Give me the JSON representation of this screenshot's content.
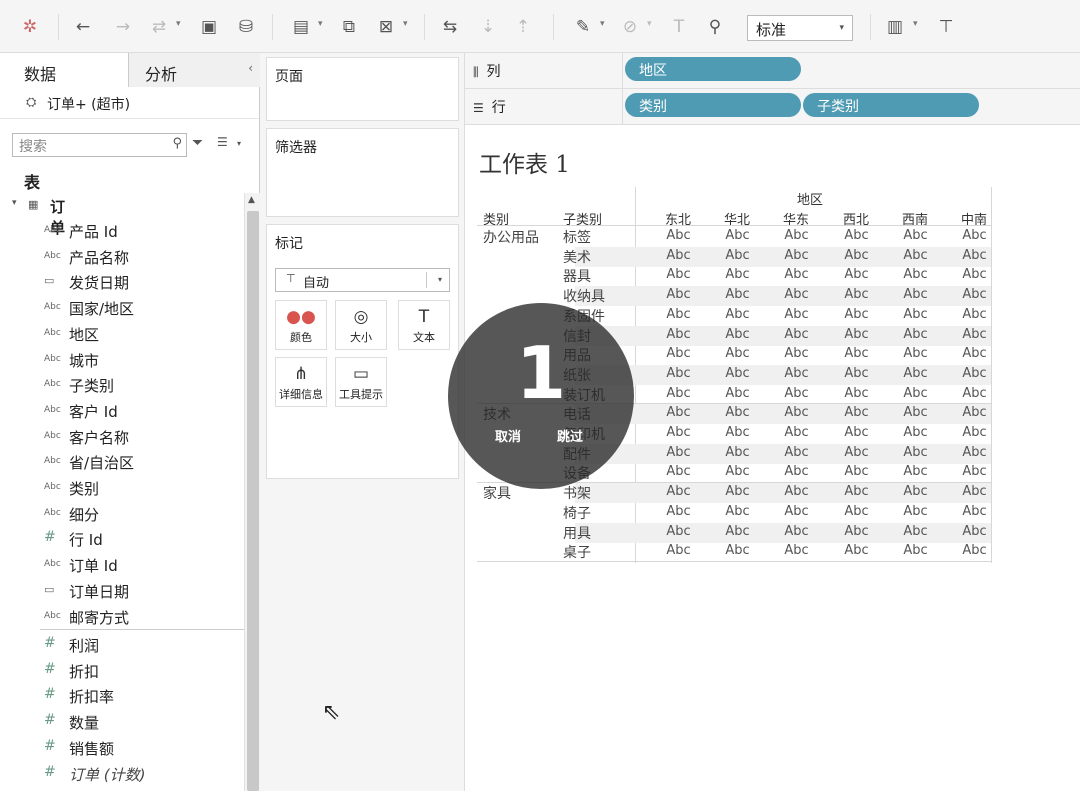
{
  "toolbar": {
    "fit_value": "标准"
  },
  "data_pane": {
    "tab_data": "数据",
    "tab_analysis": "分析",
    "datasource": "订单+ (超市)",
    "search_placeholder": "搜索",
    "section_tables": "表",
    "table_name": "订单",
    "dimensions": [
      {
        "type": "Abc",
        "name": "产品 Id"
      },
      {
        "type": "Abc",
        "name": "产品名称"
      },
      {
        "type": "date",
        "name": "发货日期"
      },
      {
        "type": "Abc",
        "name": "国家/地区"
      },
      {
        "type": "Abc",
        "name": "地区"
      },
      {
        "type": "Abc",
        "name": "城市"
      },
      {
        "type": "Abc",
        "name": "子类别"
      },
      {
        "type": "Abc",
        "name": "客户 Id"
      },
      {
        "type": "Abc",
        "name": "客户名称"
      },
      {
        "type": "Abc",
        "name": "省/自治区"
      },
      {
        "type": "Abc",
        "name": "类别"
      },
      {
        "type": "Abc",
        "name": "细分"
      },
      {
        "type": "#",
        "name": "行 Id"
      },
      {
        "type": "Abc",
        "name": "订单 Id"
      },
      {
        "type": "date",
        "name": "订单日期"
      },
      {
        "type": "Abc",
        "name": "邮寄方式"
      }
    ],
    "measures": [
      {
        "type": "#",
        "name": "利润"
      },
      {
        "type": "#",
        "name": "折扣"
      },
      {
        "type": "#",
        "name": "折扣率"
      },
      {
        "type": "#",
        "name": "数量"
      },
      {
        "type": "#",
        "name": "销售额"
      },
      {
        "type": "#",
        "name": "订单 (计数)"
      }
    ]
  },
  "cards": {
    "pages": "页面",
    "filters": "筛选器",
    "marks": "标记",
    "marks_type": "自动",
    "buttons": [
      {
        "icon": "●●",
        "label": "颜色"
      },
      {
        "icon": "◎",
        "label": "大小"
      },
      {
        "icon": "T",
        "label": "文本"
      },
      {
        "icon": "⋔",
        "label": "详细信息"
      },
      {
        "icon": "▭",
        "label": "工具提示"
      }
    ]
  },
  "shelves": {
    "columns_label": "列",
    "rows_label": "行",
    "columns_pills": [
      "地区"
    ],
    "rows_pills": [
      "类别",
      "子类别"
    ]
  },
  "view": {
    "title": "工作表 1",
    "region_header": "地区",
    "cat_header": "类别",
    "subcat_header": "子类别",
    "regions": [
      "东北",
      "华北",
      "华东",
      "西北",
      "西南",
      "中南"
    ],
    "cell_text": "Abc",
    "categories": [
      {
        "name": "办公用品",
        "subs": [
          "标签",
          "美术",
          "器具",
          "收纳具",
          "系固件",
          "信封",
          "用品",
          "纸张",
          "装订机"
        ]
      },
      {
        "name": "技术",
        "subs": [
          "电话",
          "复印机",
          "配件",
          "设备"
        ]
      },
      {
        "name": "家具",
        "subs": [
          "书架",
          "椅子",
          "用具",
          "桌子"
        ]
      }
    ]
  },
  "overlay": {
    "number": "1",
    "cancel": "取消",
    "skip": "跳过"
  }
}
